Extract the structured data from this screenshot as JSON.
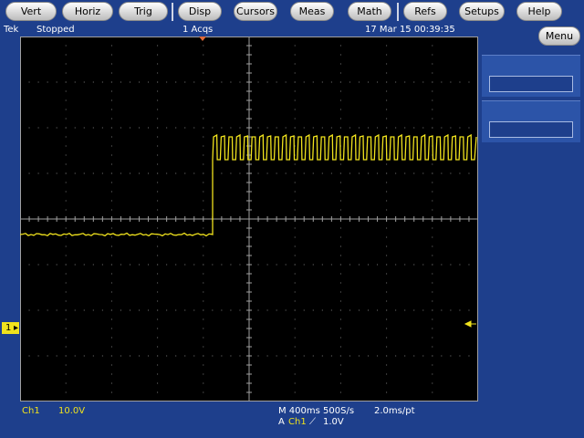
{
  "menu": {
    "vert": "Vert",
    "horiz": "Horiz",
    "trig": "Trig",
    "disp": "Disp",
    "cursors": "Cursors",
    "meas": "Meas",
    "math": "Math",
    "refs": "Refs",
    "setups": "Setups",
    "help": "Help"
  },
  "status": {
    "brand": "Tek",
    "state": "Stopped",
    "acqs": "1 Acqs",
    "datetime": "17 Mar 15 00:39:35"
  },
  "side_menu": {
    "menu_label": "Menu"
  },
  "channel": {
    "marker": "1",
    "name": "Ch1",
    "scale": "10.0V"
  },
  "timebase": {
    "line": "M 400ms 500S/s",
    "per_point": "2.0ms/pt"
  },
  "trigger": {
    "prefix": "A",
    "source": "Ch1",
    "slope_icon": "rising-slope-icon",
    "level": "1.0V"
  },
  "colors": {
    "background": "#000000",
    "frame": "#1e3f8c",
    "trace": "#f0e21d",
    "trigger_marker": "#e06a3a"
  },
  "waveform": {
    "kind": "digital-burst",
    "low_fraction_of_sweep": 0.42,
    "pulse_count": 34,
    "units": "divisions"
  }
}
